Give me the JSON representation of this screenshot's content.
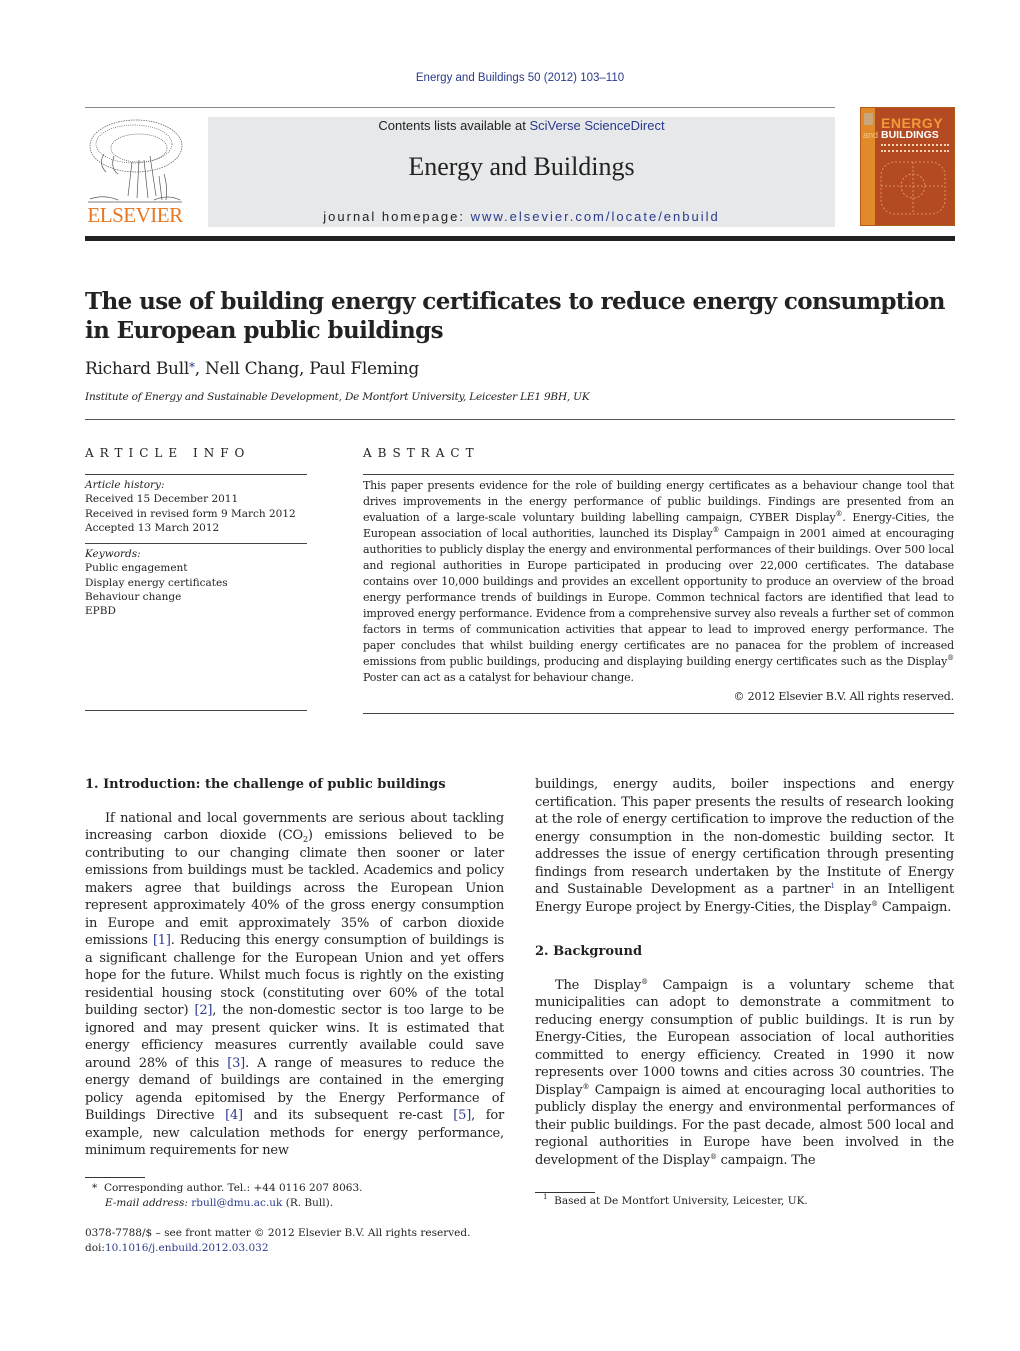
{
  "header": {
    "running_head": "Energy and Buildings 50 (2012) 103–110",
    "contents_prefix": "Contents lists available at ",
    "contents_link": "SciVerse ScienceDirect",
    "journal_title": "Energy and Buildings",
    "homepage_prefix": "journal homepage: ",
    "homepage_link": "www.elsevier.com/locate/enbuild",
    "publisher_logo_text": "ELSEVIER",
    "cover": {
      "title_top": "ENERGY",
      "title_and": "and",
      "title_bottom": "BUILDINGS"
    }
  },
  "article": {
    "title": "The use of building energy certificates to reduce energy consumption in European public buildings",
    "authors": [
      {
        "name": "Richard Bull",
        "mark": "*"
      },
      {
        "name": "Nell Chang",
        "mark": ""
      },
      {
        "name": "Paul Fleming",
        "mark": ""
      }
    ],
    "author_sep": ", ",
    "affiliation": "Institute of Energy and Sustainable Development, De Montfort University, Leicester LE1 9BH, UK"
  },
  "article_info": {
    "heading": "ARTICLE INFO",
    "history_title": "Article history:",
    "history": [
      "Received 15 December 2011",
      "Received in revised form 9 March 2012",
      "Accepted 13 March 2012"
    ],
    "keywords_title": "Keywords:",
    "keywords": [
      "Public engagement",
      "Display energy certificates",
      "Behaviour change",
      "EPBD"
    ]
  },
  "abstract": {
    "heading": "ABSTRACT",
    "segments": [
      "This paper presents evidence for the role of building energy certificates as a behaviour change tool that drives improvements in the energy performance of public buildings. Findings are presented from an evaluation of a large-scale voluntary building labelling campaign, CYBER Display",
      "®",
      ". Energy-Cities, the European association of local authorities, launched its Display",
      "®",
      " Campaign in 2001 aimed at encouraging authorities to publicly display the energy and environmental performances of their buildings. Over 500 local and regional authorities in Europe participated in producing over 22,000 certificates. The database contains over 10,000 buildings and provides an excellent opportunity to produce an overview of the broad energy performance trends of buildings in Europe. Common technical factors are identified that lead to improved energy performance. Evidence from a comprehensive survey also reveals a further set of common factors in terms of communication activities that appear to lead to improved energy performance. The paper concludes that whilst building energy certificates are no panacea for the problem of increased emissions from public buildings, producing and displaying building energy certificates such as the Display",
      "®",
      " Poster can act as a catalyst for behaviour change."
    ],
    "copyright": "© 2012 Elsevier B.V. All rights reserved."
  },
  "body": {
    "section1": {
      "heading": "1.  Introduction: the challenge of public buildings",
      "p1": {
        "a": "If national and local governments are serious about tackling increasing carbon dioxide (CO",
        "sub": "2",
        "b": ") emissions believed to be contributing to our changing climate then sooner or later emissions from buildings must be tackled. Academics and policy makers agree that buildings across the European Union represent approximately 40% of the gross energy consumption in Europe and emit approximately 35% of carbon dioxide emissions ",
        "ref1": "[1]",
        "c": ". Reducing this energy consumption of buildings is a significant challenge for the European Union and yet offers hope for the future. Whilst much focus is rightly on the existing residential housing stock (constituting over 60% of the total building sector) ",
        "ref2": "[2]",
        "d": ", the non-domestic sector is too large to be ignored and may present quicker wins. It is estimated that energy efficiency measures currently available could save around 28% of this ",
        "ref3": "[3]",
        "e": ". A range of measures to reduce the energy demand of buildings are contained in the emerging policy agenda epitomised by the Energy Performance of Buildings Directive ",
        "ref4": "[4]",
        "f": " and its subsequent re-cast ",
        "ref5": "[5]",
        "g": ", for example, new calculation methods for energy performance, minimum requirements for new"
      },
      "p1_cont": {
        "a": "buildings, energy audits, boiler inspections and energy certification. This paper presents the results of research looking at the role of energy certification to improve the reduction of the energy consumption in the non-domestic building sector. It addresses the issue of energy certification through presenting findings from research undertaken by the Institute of Energy and Sustainable Development as a partner",
        "fn": "1",
        "b": " in an Intelligent Energy Europe project by Energy-Cities, the Display",
        "reg": "®",
        "c": " Campaign."
      }
    },
    "section2": {
      "heading": "2.  Background",
      "p1": {
        "a": "The Display",
        "reg1": "®",
        "b": " Campaign is a voluntary scheme that municipalities can adopt to demonstrate a commitment to reducing energy consumption of public buildings. It is run by Energy-Cities, the European association of local authorities committed to energy efficiency. Created in 1990 it now represents over 1000 towns and cities across 30 countries. The Display",
        "reg2": "®",
        "c": " Campaign is aimed at encouraging local authorities to publicly display the energy and environmental performances of their public buildings. For the past decade, almost 500 local and regional authorities in Europe have been involved in the development of the Display",
        "reg3": "®",
        "d": " campaign. The"
      }
    }
  },
  "footnotes": {
    "corresponding_mark": "*",
    "corresponding": "Corresponding author. Tel.: +44 0116 207 8063.",
    "email_label": "E-mail address:",
    "email": "rbull@dmu.ac.uk",
    "email_suffix": " (R. Bull).",
    "front_matter": "0378-7788/$ – see front matter © 2012 Elsevier B.V. All rights reserved.",
    "doi_prefix": "doi:",
    "doi": "10.1016/j.enbuild.2012.03.032",
    "fn1_mark": "1",
    "fn1": "Based at De Montfort University, Leicester, UK."
  }
}
